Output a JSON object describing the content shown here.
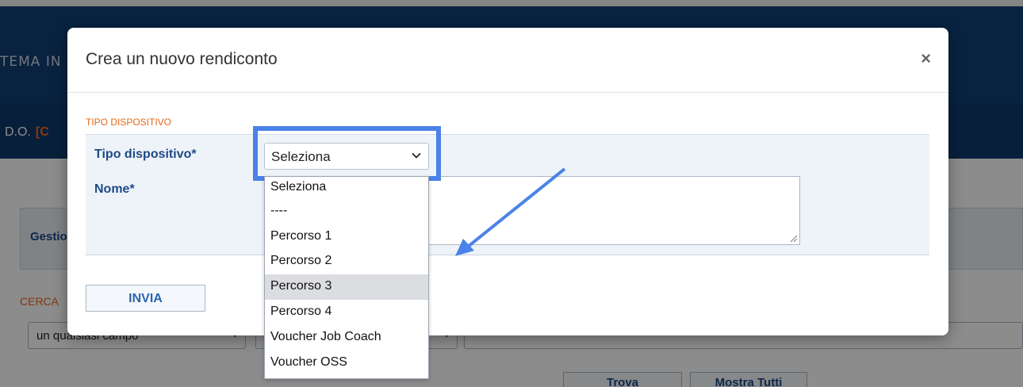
{
  "background": {
    "app_title": "TEMA IN",
    "ddo_label": "D.O.",
    "ddo_code": "[C",
    "section_title": "Gestion",
    "search_label": "CERCA",
    "search_field_select": "un qualsiasi campo",
    "find_button": "Trova",
    "show_all_button": "Mostra Tutti"
  },
  "modal": {
    "title": "Crea un nuovo rendiconto",
    "close_icon": "×",
    "section_label": "TIPO DISPOSITIVO",
    "fields": {
      "tipo_label": "Tipo dispositivo*",
      "tipo_value": "Seleziona",
      "nome_label": "Nome*"
    },
    "submit_label": "INVIA"
  },
  "dropdown": {
    "options": [
      "Seleziona",
      "----",
      "Percorso 1",
      "Percorso 2",
      "Percorso 3",
      "Percorso 4",
      "Voucher Job Coach",
      "Voucher OSS"
    ],
    "highlighted": "Percorso 3"
  },
  "colors": {
    "brand_navy": "#0f3e73",
    "label_blue": "#1d4a85",
    "accent_orange": "#e8671a",
    "highlight_blue": "#4a82e8"
  },
  "icons": {
    "close": "close-icon",
    "dropdown": "chevron-down-icon",
    "resize": "resize-grip-icon",
    "annotation": "arrow-annotation-icon"
  }
}
